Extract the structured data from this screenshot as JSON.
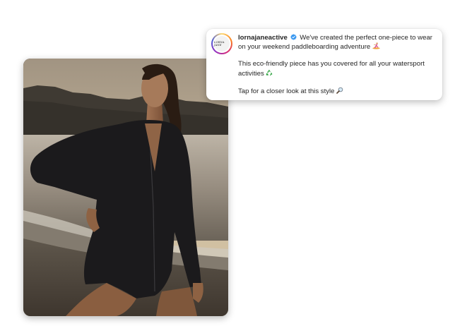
{
  "post": {
    "username": "lornajaneactive",
    "avatar_logo_text": "LORNA JANE",
    "caption_line1": "We've created the perfect one-piece to wear on your weekend paddleboarding adventure",
    "caption_line2": "This eco-friendly piece has you covered for all your watersport activities",
    "caption_line3": "Tap for a closer look at this style",
    "icons": {
      "verified": "verified-badge-icon",
      "surfer": "surfer-emoji-icon",
      "recycle": "recycle-emoji-icon",
      "magnifier": "magnifying-glass-emoji-icon"
    },
    "colors": {
      "verified_blue": "#3897f0",
      "recycle_green": "#3aa84a"
    }
  }
}
